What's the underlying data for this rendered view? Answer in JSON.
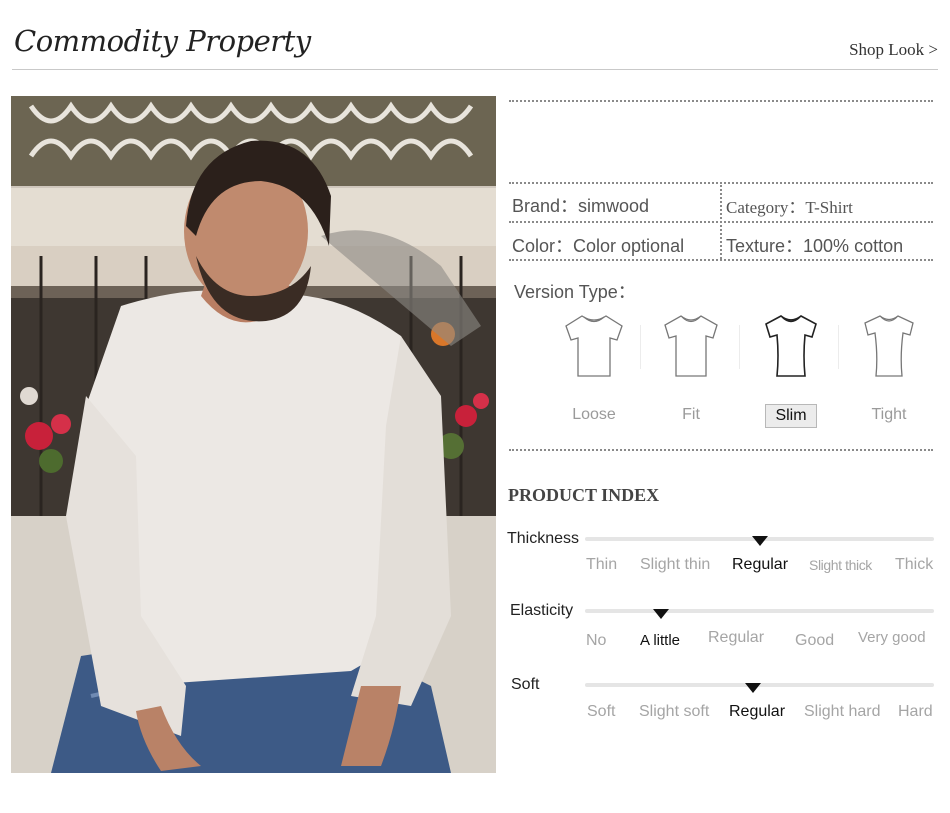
{
  "header": {
    "title": "Commodity Property",
    "shop_look": "Shop Look >"
  },
  "photo": {
    "alt": "Model wearing white long sleeve t-shirt and jeans"
  },
  "specs": {
    "brand": "Brand：simwood",
    "category": "Category：T-Shirt",
    "color": "Color：Color optional",
    "texture": "Texture：100% cotton"
  },
  "version": {
    "title": "Version Type：",
    "options": [
      {
        "label": "Loose",
        "selected": false
      },
      {
        "label": "Fit",
        "selected": false
      },
      {
        "label": "Slim",
        "selected": true
      },
      {
        "label": "Tight",
        "selected": false
      }
    ]
  },
  "product_index": {
    "title": "PRODUCT INDEX",
    "rows": [
      {
        "name": "Thickness",
        "levels": [
          "Thin",
          "Slight thin",
          "Regular",
          "Slight thick",
          "Thick"
        ],
        "selected": "Regular"
      },
      {
        "name": "Elasticity",
        "levels": [
          "No",
          "A little",
          "Regular",
          "Good",
          "Very good"
        ],
        "selected": "A little"
      },
      {
        "name": "Soft",
        "levels": [
          "Soft",
          "Slight soft",
          "Regular",
          "Slight hard",
          "Hard"
        ],
        "selected": "Regular"
      }
    ]
  },
  "colors": {
    "selected_text": "#111111",
    "muted_text": "#a5a5a5",
    "track": "#e5e5e5"
  }
}
